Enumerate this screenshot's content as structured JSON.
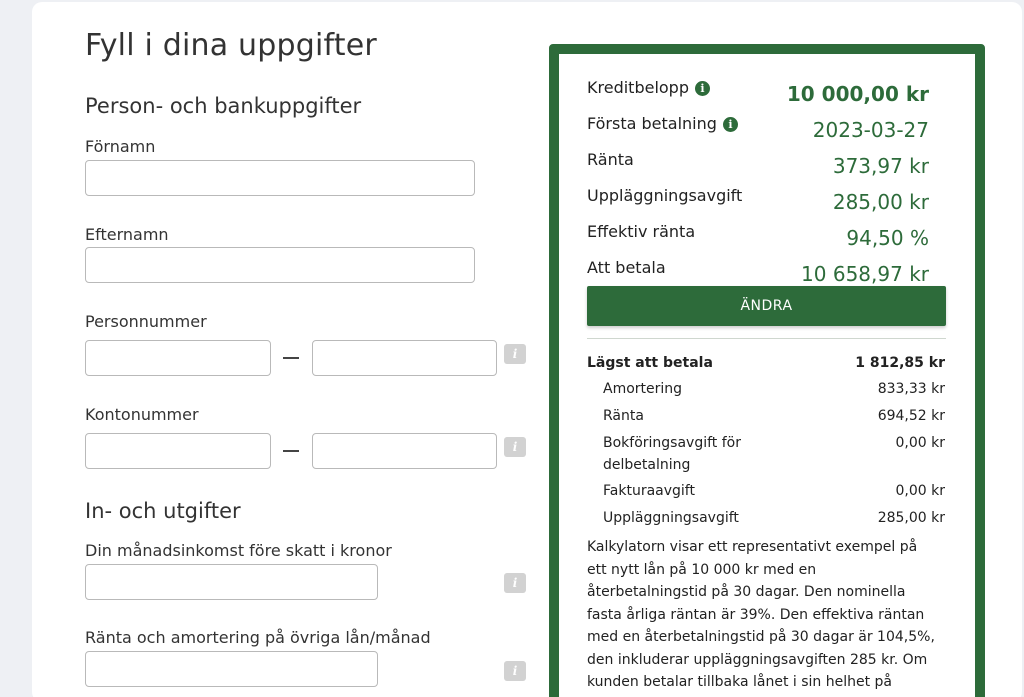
{
  "form": {
    "title": "Fyll i dina uppgifter",
    "section_person": "Person- och bankuppgifter",
    "fornamn_label": "Förnamn",
    "efternamn_label": "Efternamn",
    "personnummer_label": "Personnummer",
    "kontonummer_label": "Kontonummer",
    "section_income": "In- och utgifter",
    "income_label": "Din månadsinkomst före skatt i kronor",
    "loans_label": "Ränta och amortering på övriga lån/månad",
    "info_glyph": "i"
  },
  "summary": {
    "kreditbelopp_label": "Kreditbelopp",
    "kreditbelopp_value": "10 000,00 kr",
    "forsta_betalning_label": "Första betalning",
    "forsta_betalning_value": "2023-03-27",
    "ranta_label": "Ränta",
    "ranta_value": "373,97 kr",
    "upplaggningsavgift_label": "Uppläggningsavgift",
    "upplaggningsavgift_value": "285,00 kr",
    "effektiv_ranta_label": "Effektiv ränta",
    "effektiv_ranta_value": "94,50 %",
    "att_betala_label": "Att betala",
    "att_betala_value": "10 658,97 kr",
    "change_button": "ÄNDRA",
    "info_glyph": "i",
    "breakdown": {
      "lagst_label": "Lägst att betala",
      "lagst_value": "1 812,85 kr",
      "amortering_label": "Amortering",
      "amortering_value": "833,33 kr",
      "ranta_label": "Ränta",
      "ranta_value": "694,52 kr",
      "bokforing_label_line1": "Bokföringsavgift för",
      "bokforing_label_line2": "delbetalning",
      "bokforing_value": "0,00 kr",
      "faktura_label": "Fakturaavgift",
      "faktura_value": "0,00 kr",
      "upplaggning_label": "Uppläggningsavgift",
      "upplaggning_value": "285,00 kr"
    },
    "disclaimer": "Kalkylatorn visar ett representativt exempel på ett nytt lån på 10 000 kr med en återbetalningstid på 30 dagar. Den nominella fasta årliga räntan är 39%. Den effektiva räntan med en återbetalningstid på 30 dagar är 104,5%, den inkluderar uppläggningsavgiften 285 kr. Om kunden betalar tillbaka lånet i sin helhet på förfallodagen är det totala beloppet som ska"
  },
  "colors": {
    "brand_green": "#2d6b3a",
    "page_background": "#eef0f4",
    "info_box_grey": "#d2d2d2"
  }
}
